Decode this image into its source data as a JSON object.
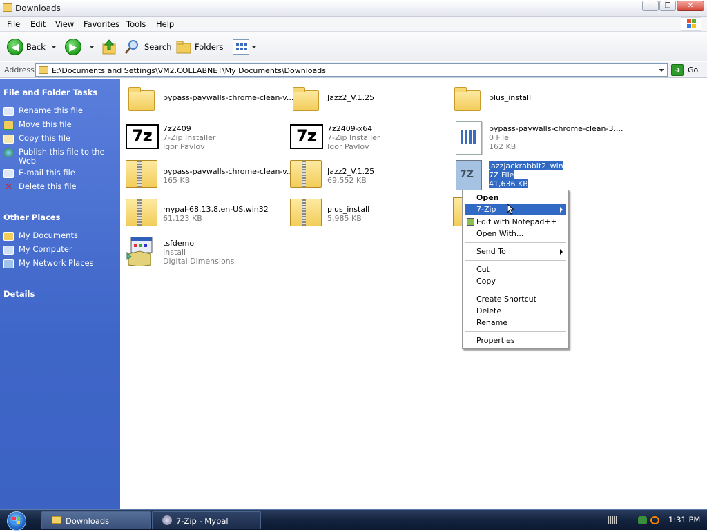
{
  "window": {
    "title": "Downloads"
  },
  "menubar": {
    "items": [
      "File",
      "Edit",
      "View",
      "Favorites",
      "Tools",
      "Help"
    ]
  },
  "toolbar": {
    "back": "Back",
    "search": "Search",
    "folders": "Folders"
  },
  "address": {
    "label": "Address",
    "value": "E:\\Documents and Settings\\VM2.COLLABNET\\My Documents\\Downloads",
    "go": "Go"
  },
  "sidebar": {
    "file_tasks_title": "File and Folder Tasks",
    "file_tasks": [
      "Rename this file",
      "Move this file",
      "Copy this file",
      "Publish this file to the Web",
      "E-mail this file",
      "Delete this file"
    ],
    "other_places_title": "Other Places",
    "other_places": [
      "My Documents",
      "My Computer",
      "My Network Places"
    ],
    "details_title": "Details"
  },
  "files": [
    {
      "name": "bypass-paywalls-chrome-clean-v...",
      "type": "folder"
    },
    {
      "name": "Jazz2_V.1.25",
      "type": "folder"
    },
    {
      "name": "plus_install",
      "type": "folder"
    },
    {
      "name": "7z2409",
      "line2": "7-Zip Installer",
      "line3": "Igor Pavlov",
      "type": "7z"
    },
    {
      "name": "7z2409-x64",
      "line2": "7-Zip Installer",
      "line3": "Igor Pavlov",
      "type": "7z"
    },
    {
      "name": "bypass-paywalls-chrome-clean-3....",
      "line2": "0 File",
      "line3": "162 KB",
      "type": "doc"
    },
    {
      "name": "bypass-paywalls-chrome-clean-v...",
      "line2": "165 KB",
      "type": "zip"
    },
    {
      "name": "Jazz2_V.1.25",
      "line2": "69,552 KB",
      "type": "zip"
    },
    {
      "name": "jazzjackrabbit2_win",
      "line2": "7Z File",
      "line3": "41,636 KB",
      "type": "7zfile"
    },
    {
      "name": "mypal-68.13.8.en-US.win32",
      "line2": "61,123 KB",
      "type": "zip"
    },
    {
      "name": "plus_install",
      "line2": "5,985 KB",
      "type": "zip"
    },
    {
      "name": "tsfdemo",
      "line2": "Install",
      "line3": "Digital Dimensions",
      "type": "installer"
    }
  ],
  "context_menu": {
    "open": "Open",
    "sevenzip": "7-Zip",
    "notepad": "Edit with Notepad++",
    "open_with": "Open With...",
    "send_to": "Send To",
    "cut": "Cut",
    "copy": "Copy",
    "create_shortcut": "Create Shortcut",
    "delete": "Delete",
    "rename": "Rename",
    "properties": "Properties"
  },
  "taskbar": {
    "task1": "Downloads",
    "task2": "7-Zip - Mypal",
    "clock": "1:31 PM"
  }
}
